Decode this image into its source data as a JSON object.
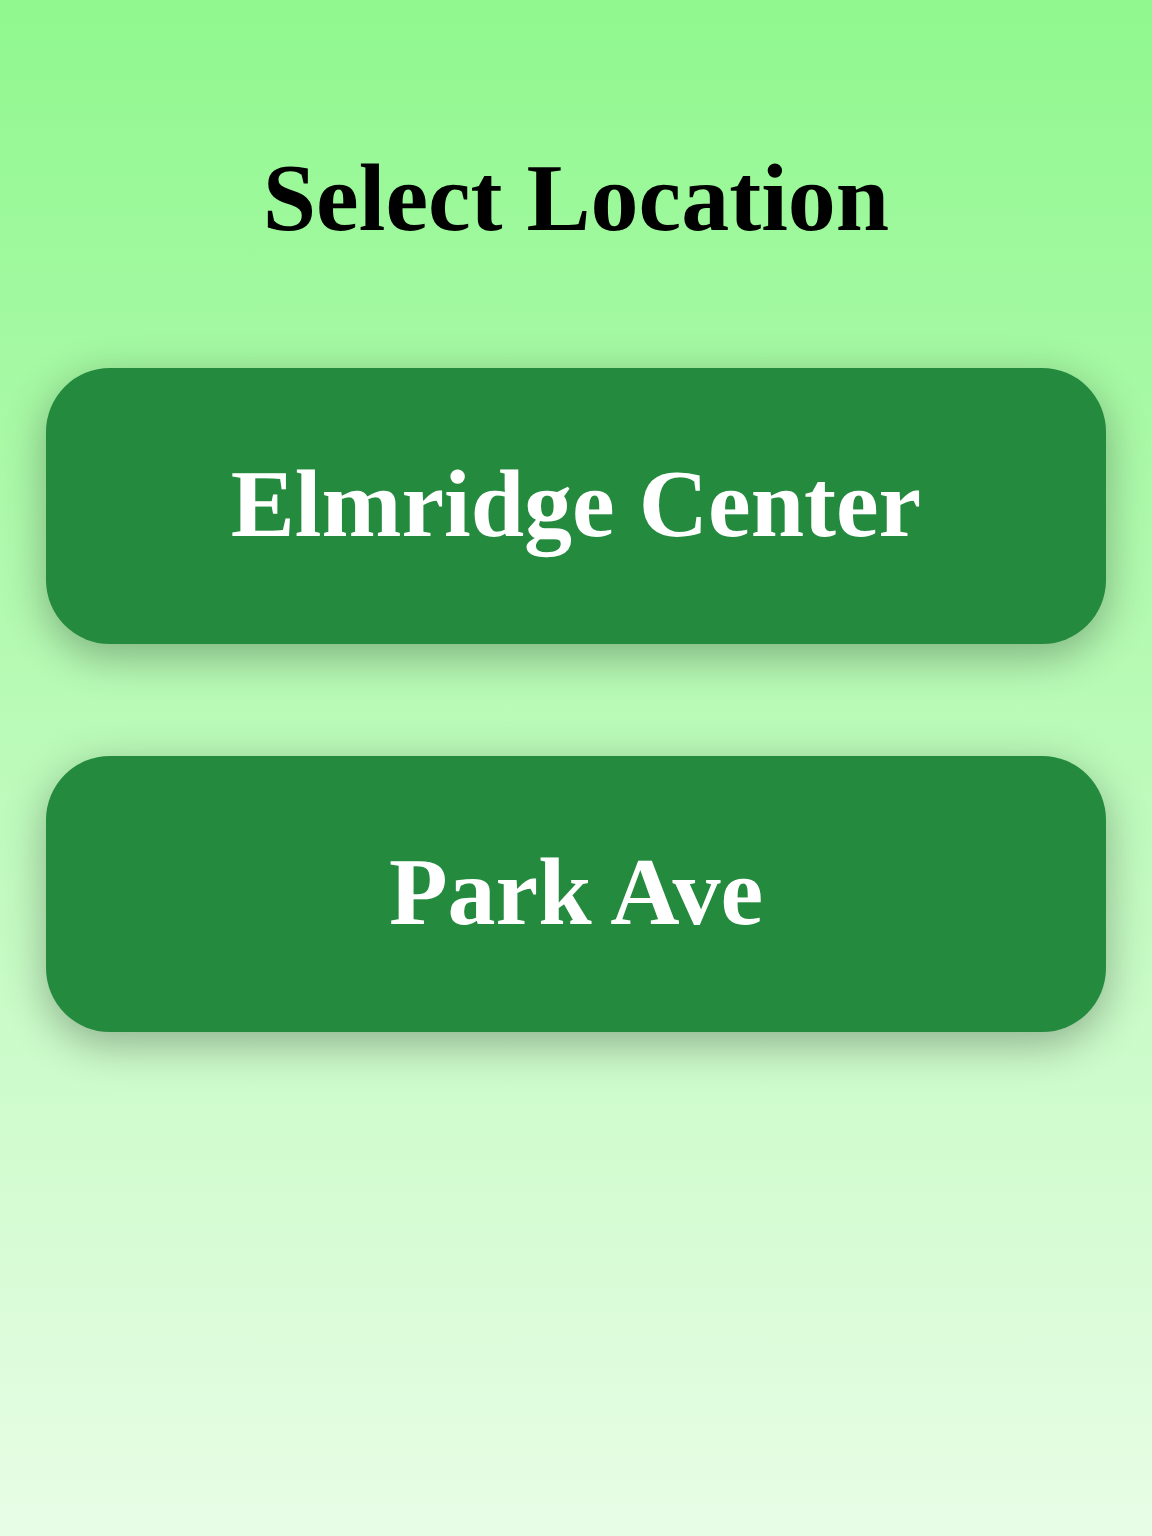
{
  "title": "Select Location",
  "locations": [
    {
      "label": "Elmridge Center"
    },
    {
      "label": "Park Ave"
    }
  ]
}
